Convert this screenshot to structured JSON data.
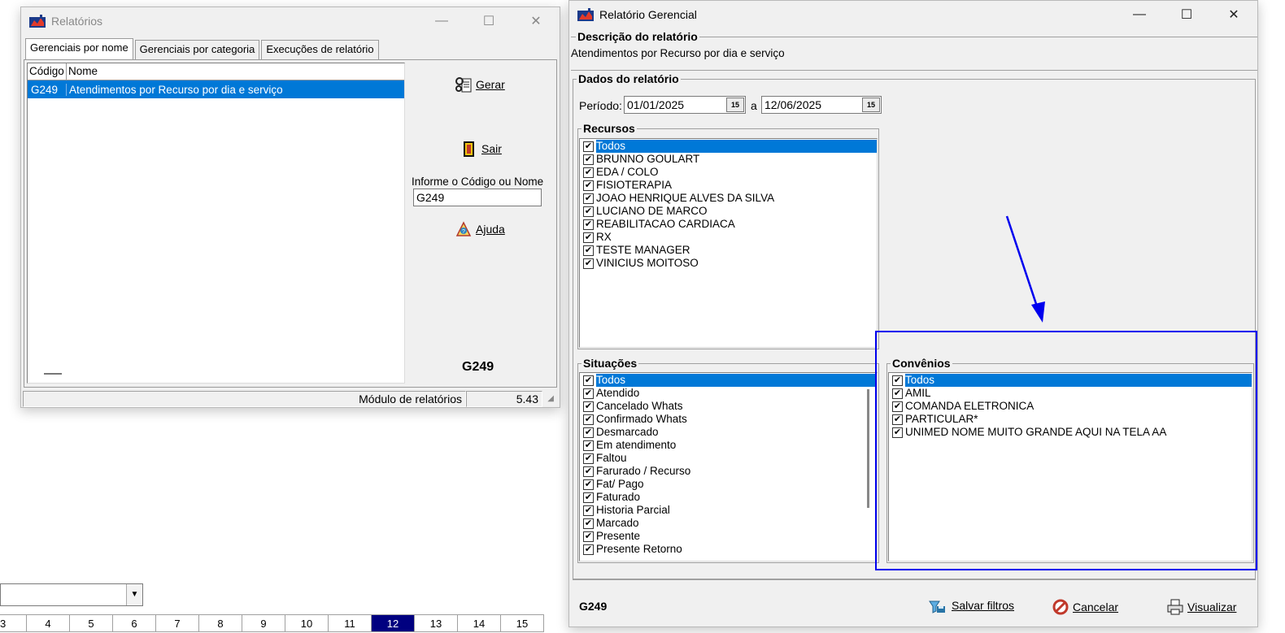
{
  "relatorios": {
    "title": "Relatórios",
    "tabs": [
      "Gerenciais por nome",
      "Gerenciais por categoria",
      "Execuções de relatório"
    ],
    "table": {
      "headers": [
        "Código",
        "Nome"
      ],
      "rows": [
        {
          "code": "G249",
          "name": "Atendimentos por Recurso por dia e serviço"
        }
      ]
    },
    "gerar_label": "Gerar",
    "sair_label": "Sair",
    "code_prompt": "Informe o Código ou Nome",
    "code_value": "G249",
    "ajuda_label": "Ajuda",
    "selected_code": "G249",
    "status_left": "Módulo de relatórios",
    "status_right": "5.43"
  },
  "gerencial": {
    "title": "Relatório Gerencial",
    "descricao_title": "Descrição do relatório",
    "descricao_text": "Atendimentos por Recurso por dia e serviço",
    "dados_title": "Dados do relatório",
    "periodo_label": "Período:",
    "date_from": "01/01/2025",
    "date_sep": "a",
    "date_to": "12/06/2025",
    "cal_icon_text": "15",
    "recursos_title": "Recursos",
    "recursos": [
      "Todos",
      "BRUNNO GOULART",
      "EDA / COLO",
      "FISIOTERAPIA",
      "JOAO HENRIQUE ALVES DA SILVA",
      "LUCIANO DE MARCO",
      "REABILITACAO CARDIACA",
      "RX",
      "TESTE  MANAGER",
      "VINICIUS MOITOSO"
    ],
    "situacoes_title": "Situações",
    "situacoes": [
      "Todos",
      "Atendido",
      "Cancelado Whats",
      "Confirmado Whats",
      "Desmarcado",
      "Em atendimento",
      "Faltou",
      "Farurado / Recurso",
      "Fat/ Pago",
      "Faturado",
      "Historia Parcial",
      "Marcado",
      "Presente",
      "Presente Retorno"
    ],
    "convenios_title": "Convênios",
    "convenios": [
      "Todos",
      "AMIL",
      "COMANDA ELETRONICA",
      "PARTICULAR*",
      "UNIMED NOME MUITO GRANDE AQUI NA TELA AA"
    ],
    "footer_code": "G249",
    "salvar_label": "Salvar filtros",
    "cancelar_label": "Cancelar",
    "visualizar_label": "Visualizar"
  },
  "calendar_days": [
    "3",
    "4",
    "5",
    "6",
    "7",
    "8",
    "9",
    "10",
    "11",
    "12",
    "13",
    "14",
    "15"
  ],
  "today": "12",
  "colors": {
    "selection": "#0078d7",
    "annotation": "#0000ee",
    "today": "#000080"
  }
}
